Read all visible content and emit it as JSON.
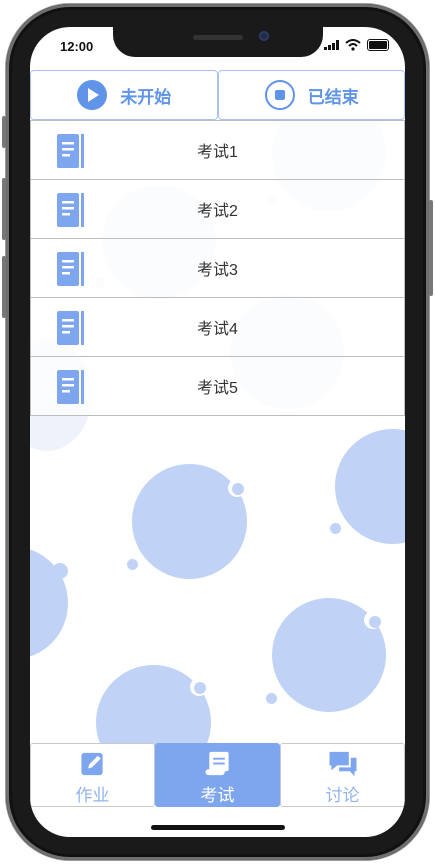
{
  "status_bar": {
    "time": "12:00"
  },
  "tabs": [
    {
      "label": "未开始",
      "icon": "play-circle-icon"
    },
    {
      "label": "已结束",
      "icon": "stop-circle-icon"
    }
  ],
  "exams": [
    {
      "label": "考试1"
    },
    {
      "label": "考试2"
    },
    {
      "label": "考试3"
    },
    {
      "label": "考试4"
    },
    {
      "label": "考试5"
    }
  ],
  "bottom_nav": [
    {
      "label": "作业",
      "icon": "edit-icon",
      "active": false
    },
    {
      "label": "考试",
      "icon": "scroll-icon",
      "active": true
    },
    {
      "label": "讨论",
      "icon": "chat-icon",
      "active": false
    }
  ],
  "colors": {
    "accent": "#5f94e8",
    "active_tab": "#7ea6ee",
    "bubble": "#c0d2f6"
  }
}
